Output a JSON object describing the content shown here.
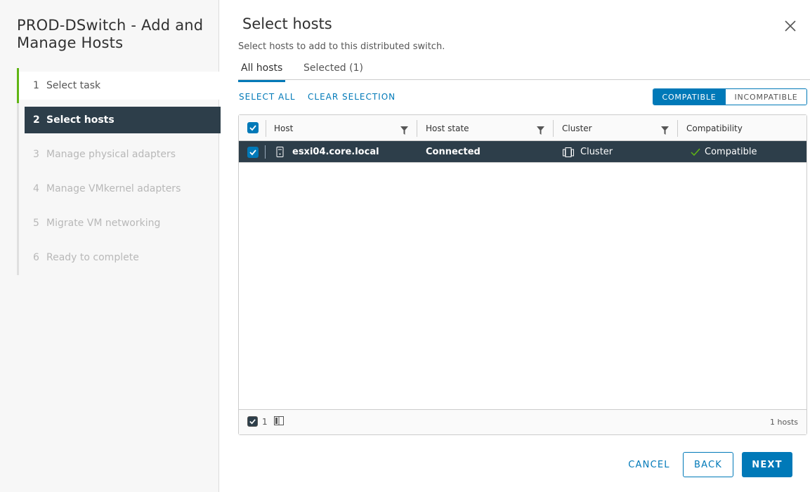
{
  "wizard": {
    "title": "PROD-DSwitch - Add and Manage Hosts",
    "steps": [
      {
        "num": "1",
        "label": "Select task",
        "state": "done"
      },
      {
        "num": "2",
        "label": "Select hosts",
        "state": "active"
      },
      {
        "num": "3",
        "label": "Manage physical adapters",
        "state": "pending"
      },
      {
        "num": "4",
        "label": "Manage VMkernel adapters",
        "state": "pending"
      },
      {
        "num": "5",
        "label": "Migrate VM networking",
        "state": "pending"
      },
      {
        "num": "6",
        "label": "Ready to complete",
        "state": "pending"
      }
    ]
  },
  "page": {
    "title": "Select hosts",
    "subtitle": "Select hosts to add to this distributed switch."
  },
  "tabs": {
    "all": "All hosts",
    "selected": "Selected (1)"
  },
  "actions": {
    "select_all": "SELECT ALL",
    "clear_selection": "CLEAR SELECTION"
  },
  "filter_toggle": {
    "compatible": "COMPATIBLE",
    "incompatible": "INCOMPATIBLE",
    "active": "compatible"
  },
  "grid": {
    "columns": [
      "Host",
      "Host state",
      "Cluster",
      "Compatibility"
    ],
    "rows": [
      {
        "host": "esxi04.core.local",
        "host_icon": "server-icon",
        "host_state": "Connected",
        "cluster": "Cluster",
        "cluster_icon": "cluster-icon",
        "compatibility": "Compatible",
        "compatibility_icon": "check-icon",
        "selected": true
      }
    ],
    "footer": {
      "selected_count": "1",
      "total": "1 hosts"
    }
  },
  "buttons": {
    "cancel": "CANCEL",
    "back": "BACK",
    "next": "NEXT"
  },
  "colors": {
    "accent": "#0079b8",
    "selected_row": "#2d3e4a",
    "done_step": "#60b515"
  }
}
